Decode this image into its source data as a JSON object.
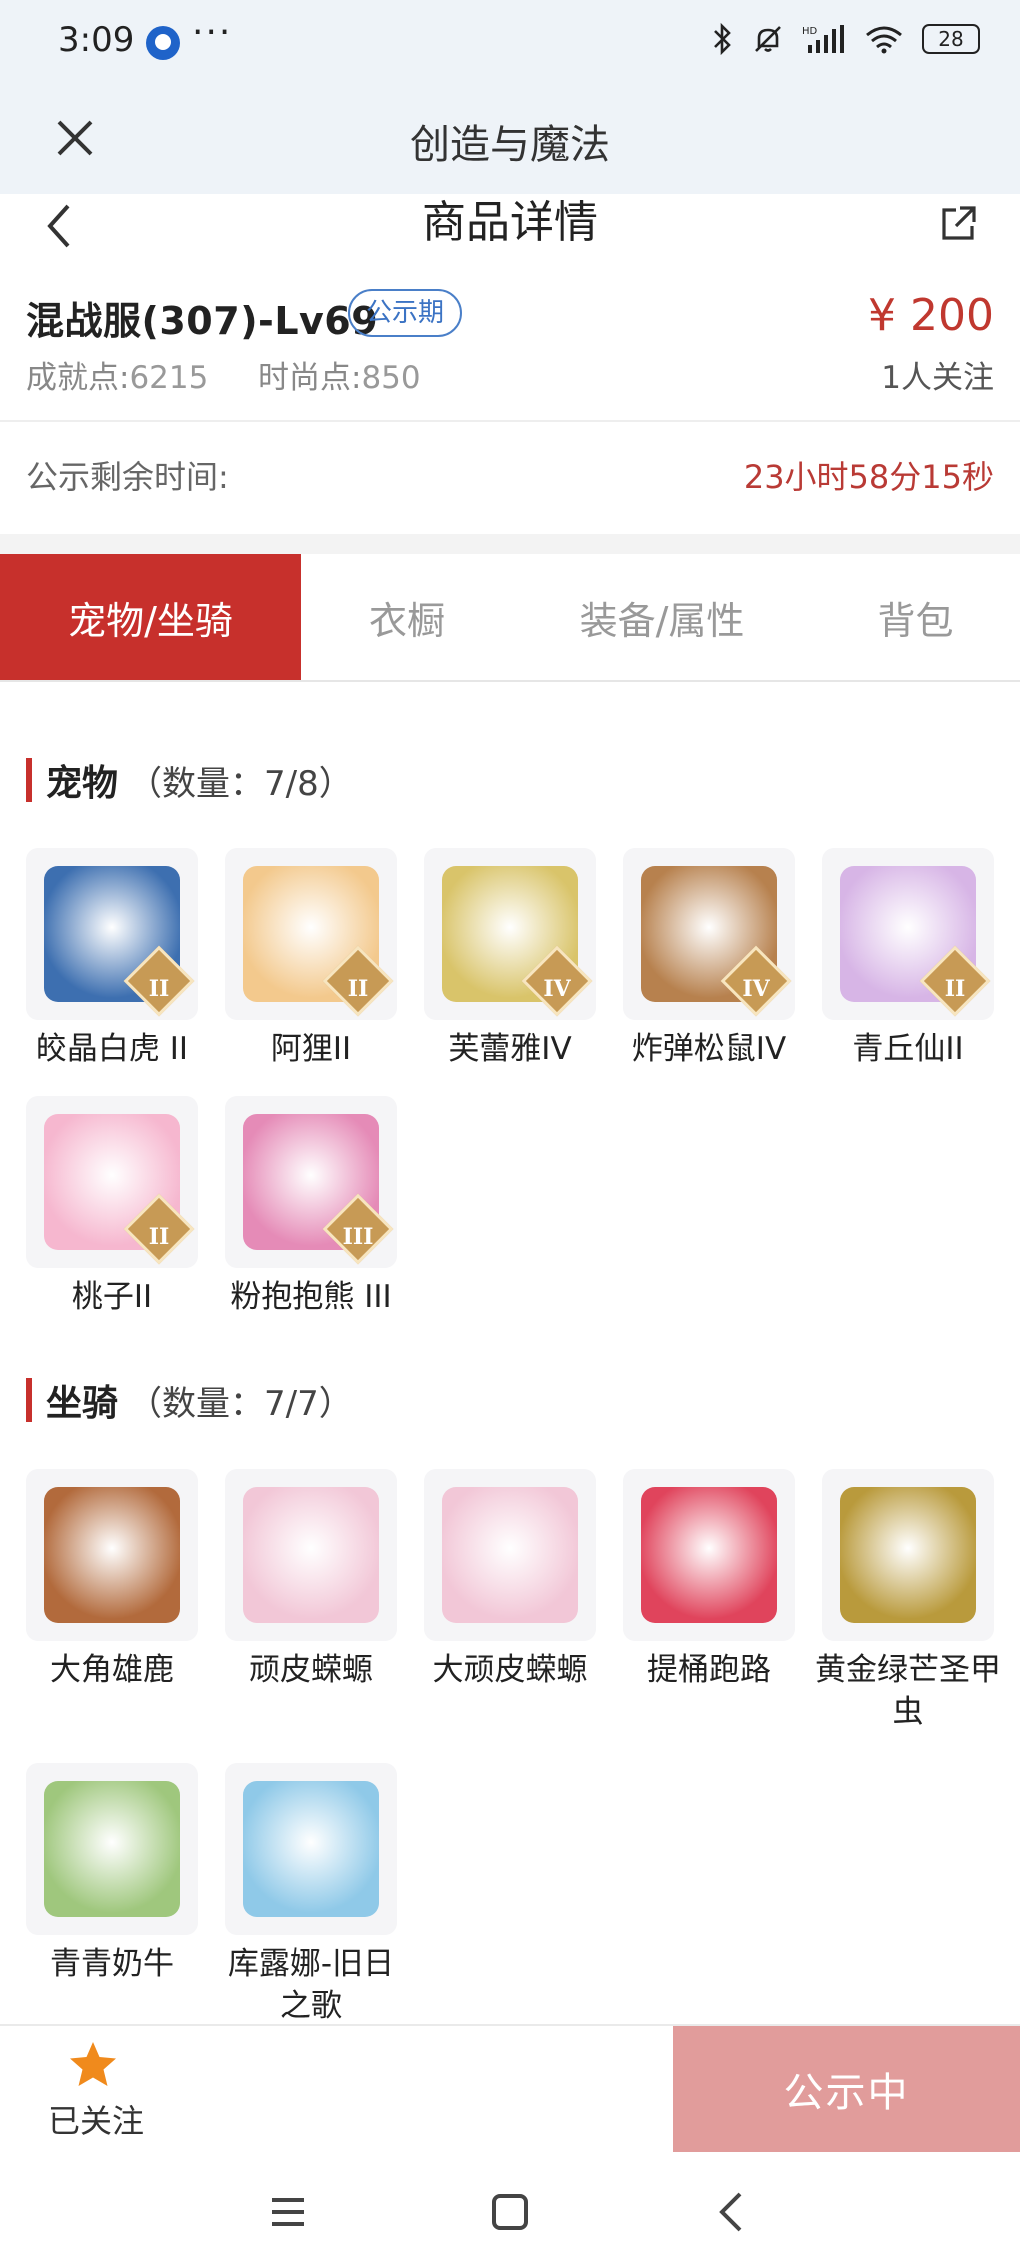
{
  "status_bar": {
    "time": "3:09",
    "dots": "···",
    "battery": "28",
    "icons": [
      "bluetooth-icon",
      "mute-icon",
      "hd-signal-icon",
      "wifi-icon",
      "battery-icon"
    ]
  },
  "app_bar": {
    "title": "创造与魔法"
  },
  "page_header": {
    "title": "商品详情"
  },
  "product": {
    "name": "混战服(307)-Lv69",
    "badge": "公示期",
    "achievement_label": "成就点:",
    "achievement_value": "6215",
    "fashion_label": "时尚点:",
    "fashion_value": "850",
    "price": "¥ 200",
    "followers": "1人关注"
  },
  "countdown": {
    "label": "公示剩余时间:",
    "value": "23小时58分15秒"
  },
  "tabs": [
    {
      "label": "宠物/坐骑",
      "active": true
    },
    {
      "label": "衣橱",
      "active": false
    },
    {
      "label": "装备/属性",
      "active": false
    },
    {
      "label": "背包",
      "active": false
    }
  ],
  "pets": {
    "title": "宠物",
    "count": "（数量：7/8）",
    "items": [
      {
        "name": "皎晶白虎 II",
        "tier": "II",
        "color": "#3d6fb0"
      },
      {
        "name": "阿狸II",
        "tier": "II",
        "color": "#f3c98d"
      },
      {
        "name": "芙蕾雅IV",
        "tier": "IV",
        "color": "#d9c46a"
      },
      {
        "name": "炸弹松鼠IV",
        "tier": "IV",
        "color": "#b7814e"
      },
      {
        "name": "青丘仙II",
        "tier": "II",
        "color": "#d7b5e6"
      },
      {
        "name": "桃子II",
        "tier": "II",
        "color": "#f6b7cf"
      },
      {
        "name": "粉抱抱熊 III",
        "tier": "III",
        "color": "#e58bb7"
      }
    ]
  },
  "mounts": {
    "title": "坐骑",
    "count": "（数量：7/7）",
    "items": [
      {
        "name": "大角雄鹿",
        "color": "#b26a3c"
      },
      {
        "name": "顽皮蝾螈",
        "color": "#f2c7d7"
      },
      {
        "name": "大顽皮蝾螈",
        "color": "#f2c7d7"
      },
      {
        "name": "提桶跑路",
        "color": "#e0445c"
      },
      {
        "name": "黄金绿芒圣甲虫",
        "color": "#b99a3c"
      },
      {
        "name": "青青奶牛",
        "color": "#9fc77d"
      },
      {
        "name": "库露娜-旧日之歌",
        "color": "#8fc9e8"
      }
    ]
  },
  "bottom": {
    "follow_label": "已关注",
    "public_label": "公示中"
  },
  "colors": {
    "accent": "#c7302c",
    "price": "#c0382f",
    "badge": "#3b73c4",
    "disabled_button": "#e19c9b"
  }
}
